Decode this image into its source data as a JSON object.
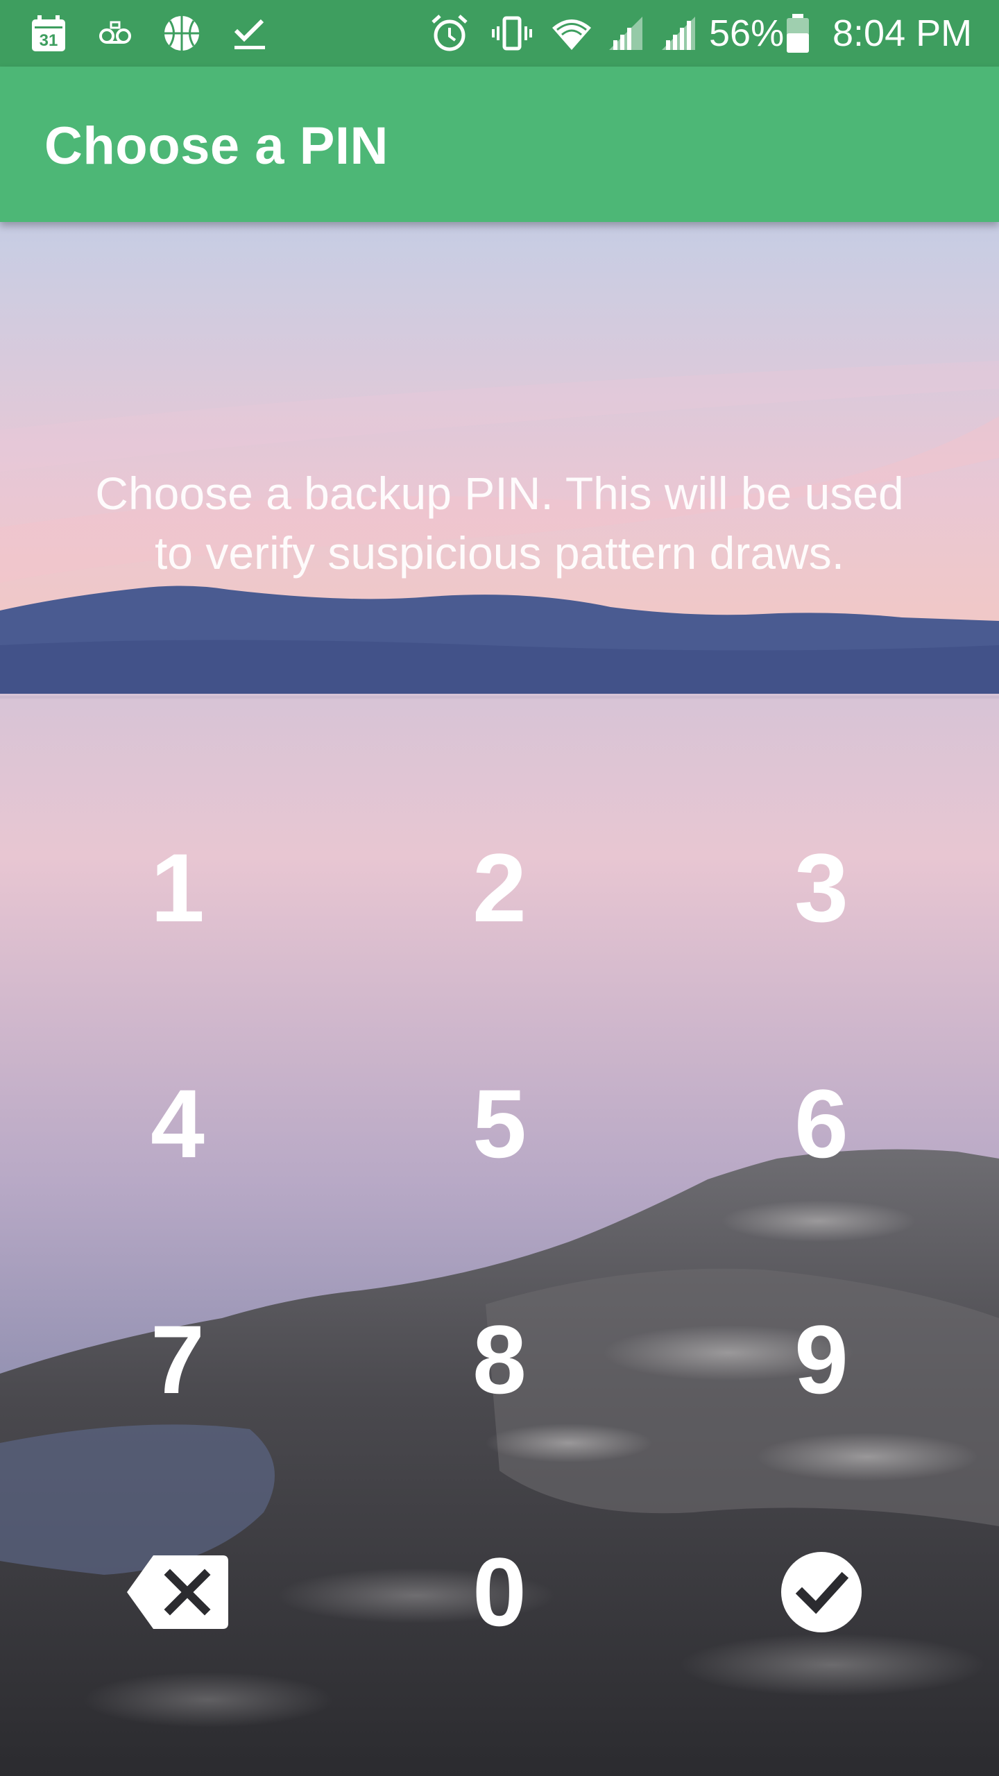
{
  "status_bar": {
    "icons": [
      "calendar-icon",
      "voicemail-icon",
      "basketball-icon",
      "task-check-icon",
      "alarm-icon",
      "vibrate-icon",
      "wifi-icon",
      "signal-icon",
      "signal-icon",
      "battery-icon"
    ],
    "calendar_day": "31",
    "battery_percent": "56%",
    "time": "8:04 PM"
  },
  "app_bar": {
    "title": "Choose a PIN"
  },
  "main": {
    "instruction_line1": "Choose a backup PIN. This will be used",
    "instruction_line2": "to verify suspicious pattern draws."
  },
  "keypad": {
    "keys": [
      "1",
      "2",
      "3",
      "4",
      "5",
      "6",
      "7",
      "8",
      "9",
      "0"
    ],
    "backspace_icon": "backspace-icon",
    "confirm_icon": "checkmark-icon"
  },
  "colors": {
    "status_bar": "#3e9e5f",
    "app_bar": "#4db776",
    "text": "#ffffff"
  }
}
